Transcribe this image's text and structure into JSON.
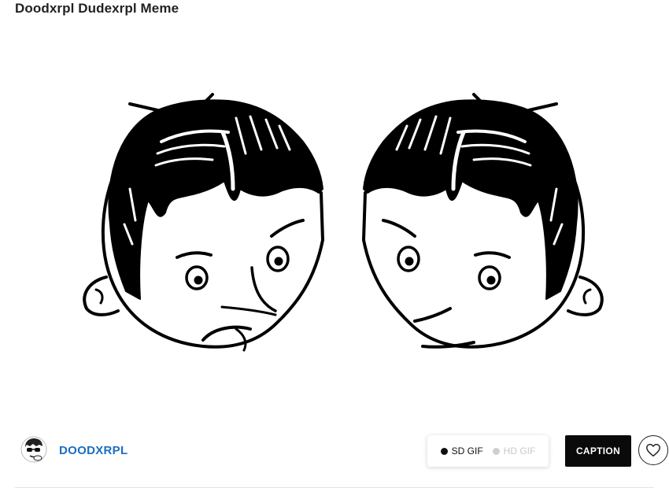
{
  "page": {
    "title": "Doodxrpl Dudexrpl Meme"
  },
  "media": {
    "description_icon": "mirrored-cartoon-heads-image"
  },
  "user": {
    "username": "DOODXRPL",
    "avatar_icon": "cartoon-avatar-with-sunglasses",
    "username_color": "#1b6ec2"
  },
  "quality": {
    "sd_label": "SD GIF",
    "hd_label": "HD GIF",
    "selected": "SD GIF"
  },
  "actions": {
    "caption_label": "CAPTION",
    "like_icon": "heart-icon"
  },
  "colors": {
    "caption_bg": "#0a0a0a",
    "text": "#222222",
    "inactive": "#c9c9c9"
  }
}
